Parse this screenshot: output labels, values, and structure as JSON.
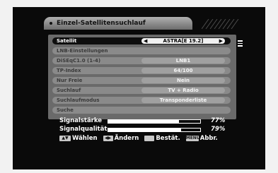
{
  "title": "Einzel-Satellitensuchlauf",
  "menu": [
    {
      "label": "Satellit",
      "value": "ASTRA[E 19.2]",
      "selected": true
    },
    {
      "label": "LNB-Einstellungen",
      "value": ""
    },
    {
      "label": "DiSEqC1.0 (1-4)",
      "value": "LNB1"
    },
    {
      "label": "TP-Index",
      "value": "64/100"
    },
    {
      "label": "Nur Freie",
      "value": "Nein"
    },
    {
      "label": "Suchlauf",
      "value": "TV + Radio"
    },
    {
      "label": "Suchlaufmodus",
      "value": "Transponderliste"
    },
    {
      "label": "Suche",
      "value": ""
    }
  ],
  "signal": {
    "strength_label": "Signalstärke",
    "strength_value": "77%",
    "strength_level": 0.77,
    "quality_label": "Signalqualität",
    "quality_value": "79%",
    "quality_level": 0.79
  },
  "footer": {
    "select_label": "Wählen",
    "change_label": "Ändern",
    "confirm_label": "Bestät.",
    "cancel_key": "MENU",
    "cancel_label": "Abbr."
  }
}
